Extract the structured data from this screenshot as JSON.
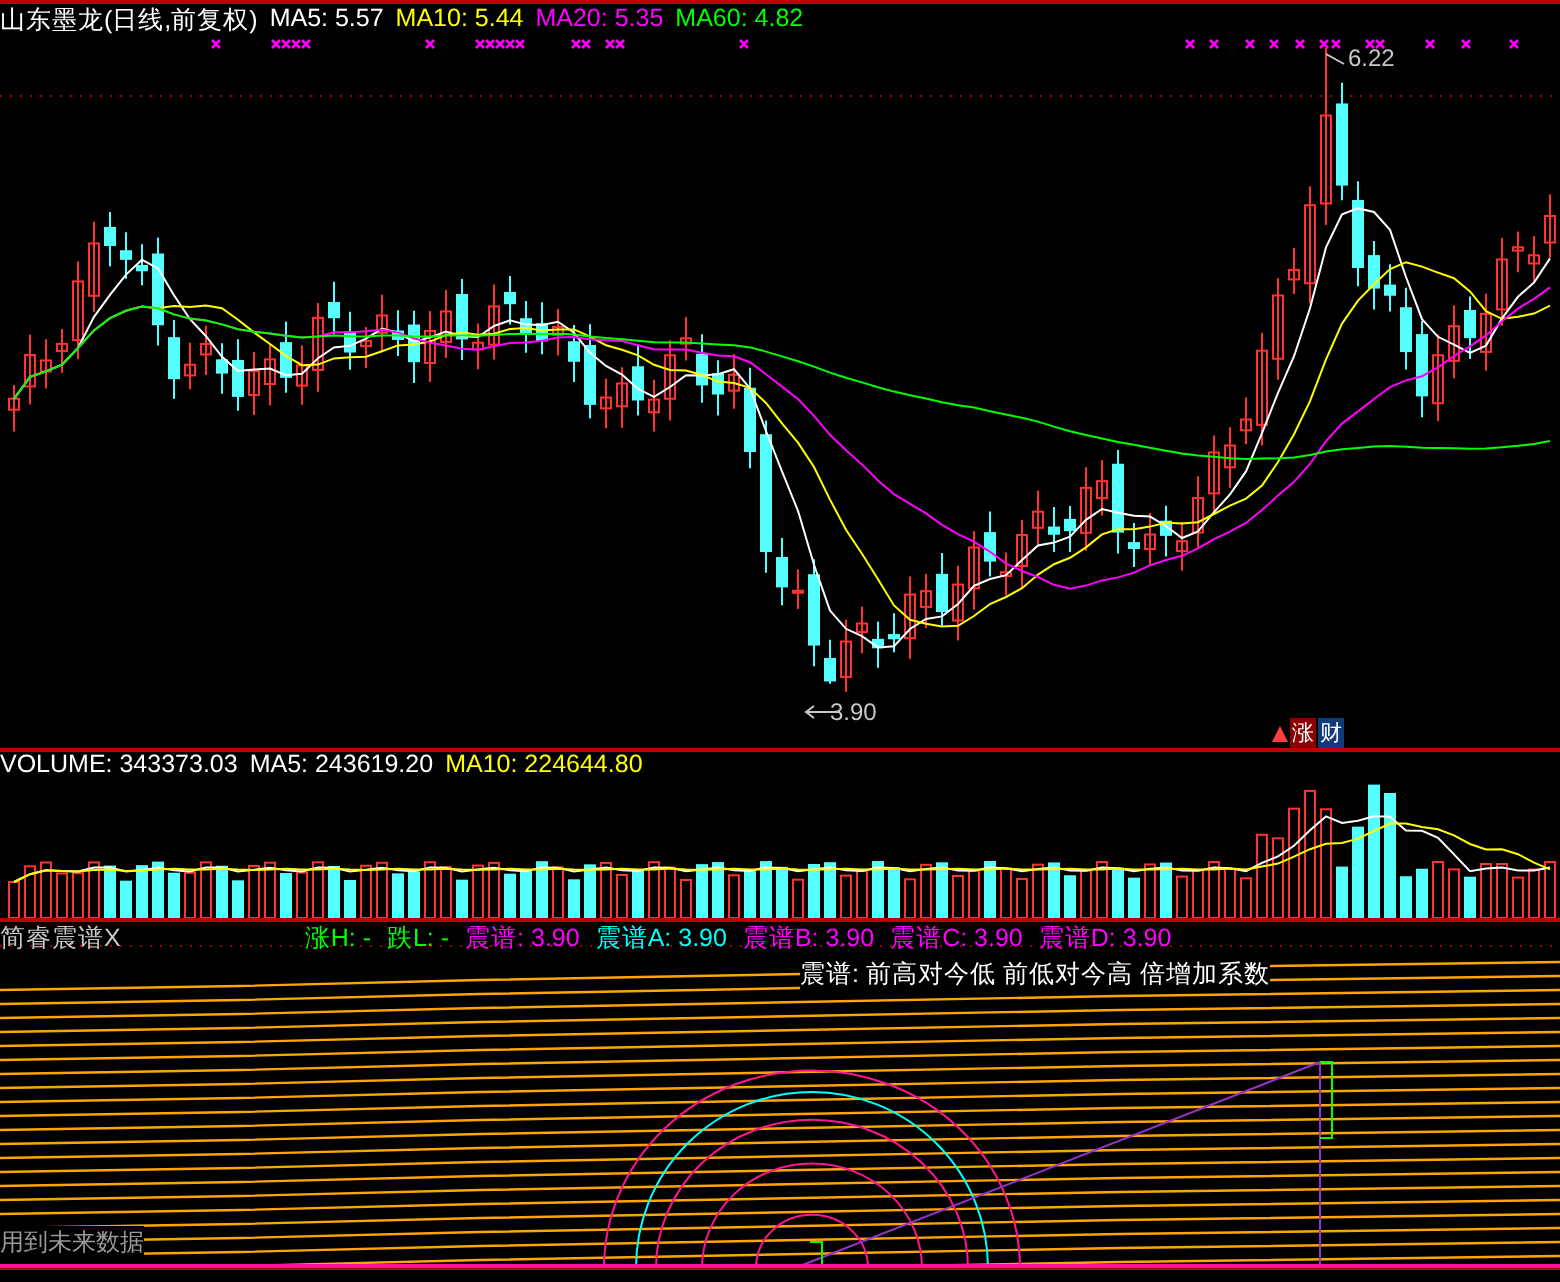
{
  "main": {
    "title": "山东墨龙(日线,前复权)",
    "ma": [
      {
        "label": "MA5:",
        "value": "5.57",
        "color": "#ffffff"
      },
      {
        "label": "MA10:",
        "value": "5.44",
        "color": "#ffff00"
      },
      {
        "label": "MA20:",
        "value": "5.35",
        "color": "#ff00ff"
      },
      {
        "label": "MA60:",
        "value": "4.82",
        "color": "#00ff00"
      }
    ],
    "high_label": "6.22",
    "low_label": "3.90",
    "badge": [
      "涨",
      "财"
    ]
  },
  "volume": {
    "items": [
      {
        "label": "VOLUME:",
        "value": "343373.03",
        "color": "#ffffff"
      },
      {
        "label": "MA5:",
        "value": "243619.20",
        "color": "#ffffff"
      },
      {
        "label": "MA10:",
        "value": "224644.80",
        "color": "#ffff00"
      }
    ]
  },
  "indicator": {
    "title": "简睿震谱X",
    "items": [
      {
        "label": "涨H:",
        "value": "-",
        "color": "#00ff00"
      },
      {
        "label": "跌L:",
        "value": "-",
        "color": "#00ff00"
      },
      {
        "label": "震谱:",
        "value": "3.90",
        "color": "#ff00ff"
      },
      {
        "label": "震谱A:",
        "value": "3.90",
        "color": "#00ffff"
      },
      {
        "label": "震谱B:",
        "value": "3.90",
        "color": "#ff00ff"
      },
      {
        "label": "震谱C:",
        "value": "3.90",
        "color": "#ff00ff"
      },
      {
        "label": "震谱D:",
        "value": "3.90",
        "color": "#ff00ff"
      }
    ],
    "note": "震谱: 前高对今低 前低对今高 倍增加系数",
    "footnote": "用到未来数据"
  }
}
